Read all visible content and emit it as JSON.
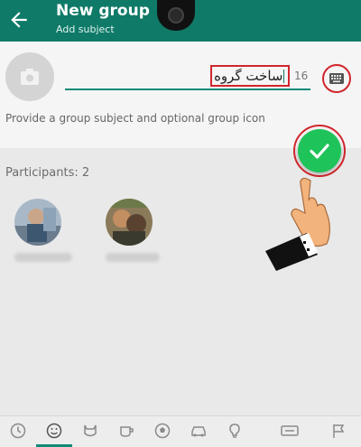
{
  "header": {
    "title": "New group",
    "subtitle": "Add subject"
  },
  "subject": {
    "value": "ساخت گروه",
    "char_count": "16",
    "helper": "Provide a group subject and optional group icon"
  },
  "participants": {
    "label": "Participants: 2",
    "items": [
      {
        "avatar": "avatar-photo-1"
      },
      {
        "avatar": "avatar-photo-2"
      }
    ]
  },
  "emoji_tabs": [
    "recent-clock-icon",
    "smiley-icon",
    "animal-icon",
    "food-icon",
    "ball-icon",
    "car-icon",
    "bulb-icon",
    "symbols-icon",
    "flag-icon"
  ],
  "colors": {
    "app_bar": "#0f7a68",
    "accent": "#1ec35a",
    "highlight": "#d0262d"
  }
}
